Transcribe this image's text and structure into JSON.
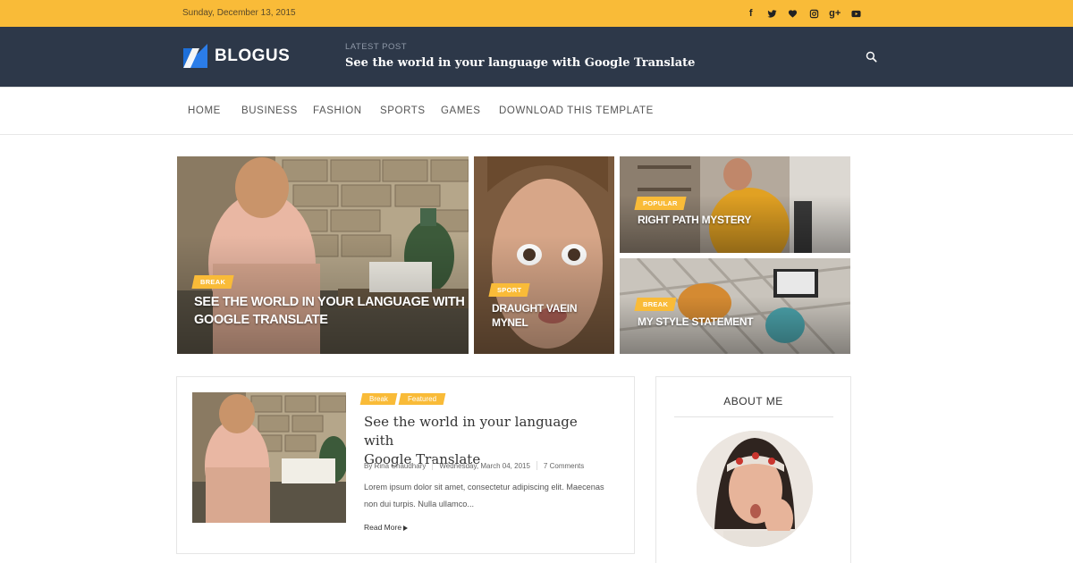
{
  "topbar": {
    "date": "Sunday, December 13, 2015",
    "social_icons": [
      "facebook-icon",
      "twitter-icon",
      "heart-icon",
      "instagram-icon",
      "google-plus-icon",
      "youtube-icon"
    ],
    "facebook_glyph": "f",
    "google_plus_glyph": "g+"
  },
  "header": {
    "logo_text": "BLOGUS",
    "latest_label": "LATEST POST",
    "latest_title": "See the world in your language with Google Translate"
  },
  "nav": {
    "items": [
      "HOME",
      "BUSINESS",
      "FASHION",
      "SPORTS",
      "GAMES",
      "DOWNLOAD THIS TEMPLATE"
    ]
  },
  "hero": {
    "main": {
      "badge": "BREAK",
      "title_line1": "SEE THE WORLD IN YOUR LANGUAGE WITH",
      "title_line2": "GOOGLE TRANSLATE"
    },
    "middle": {
      "badge": "SPORT",
      "title_line1": "DRAUGHT VAEIN",
      "title_line2": "MYNEL"
    },
    "top_right": {
      "badge": "POPULAR",
      "title": "RIGHT PATH MYSTERY"
    },
    "bottom_right": {
      "badge": "BREAK",
      "title": "MY STYLE STATEMENT"
    }
  },
  "post": {
    "tags": [
      "Break",
      "Featured"
    ],
    "title_line1": "See the world in your language with",
    "title_line2": "Google Translate",
    "author": "By Rina Chaudhary",
    "date": "Wednesday, March 04, 2015",
    "comments": "7 Comments",
    "excerpt_line1": "Lorem ipsum dolor sit amet, consectetur adipiscing elit. Maecenas",
    "excerpt_line2": "non dui turpis. Nulla ullamco...",
    "read_more": "Read More"
  },
  "sidebar": {
    "about_title": "ABOUT ME"
  },
  "colors": {
    "accent": "#f9bb38",
    "header_bg": "#2d3849",
    "logo_blue": "#2b7de9"
  }
}
